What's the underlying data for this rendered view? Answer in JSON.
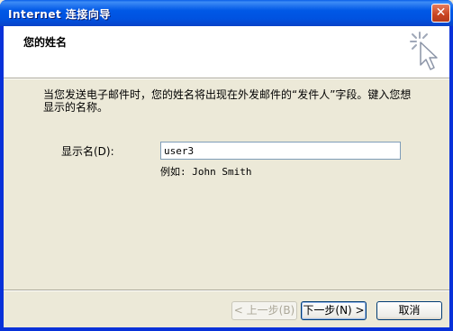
{
  "window": {
    "title": "Internet 连接向导",
    "close_glyph": "✕"
  },
  "header": {
    "title": "您的姓名",
    "icon": "wizard-star-cursor-icon"
  },
  "body": {
    "description": "当您发送电子邮件时，您的姓名将出现在外发邮件的“发件人”字段。键入您想显示的名称。",
    "display_name_label": "显示名(D):",
    "display_name_value": "user3",
    "example": "例如: John Smith"
  },
  "buttons": {
    "back": "< 上一步(B)",
    "next": "下一步(N) >",
    "cancel": "取消"
  },
  "colors": {
    "titlebar": "#0058E6",
    "dialog_face": "#ECE9D8",
    "header_bg": "#FFFFFF"
  }
}
